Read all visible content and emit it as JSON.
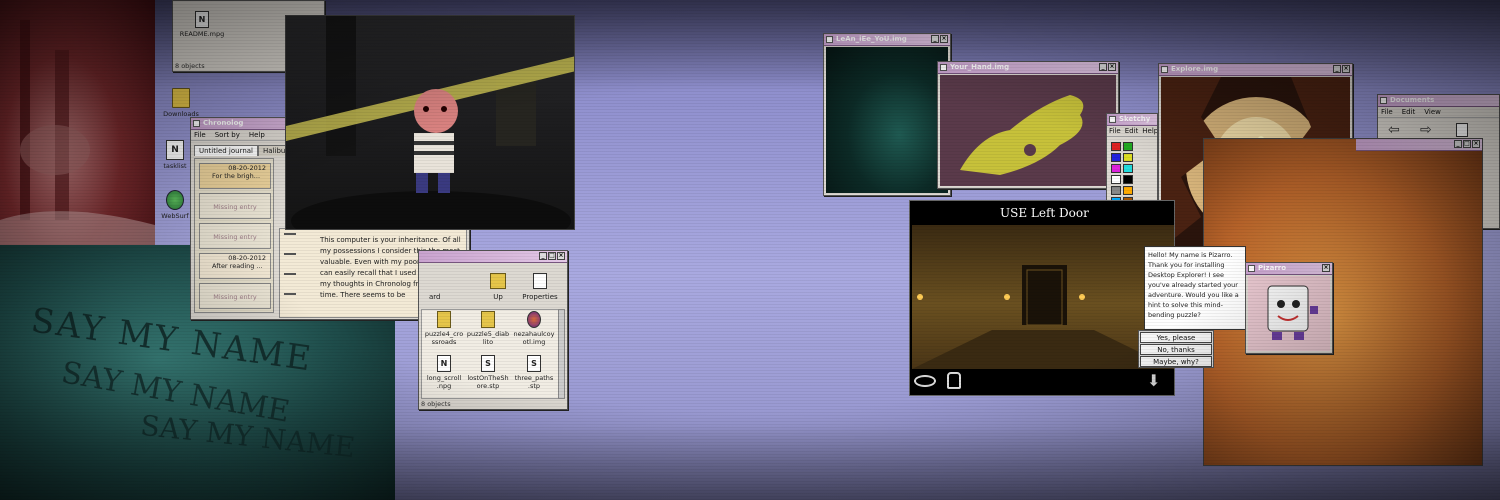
{
  "colors": {
    "desktop": "#a9a9e0",
    "titlebar": "#c9a3cf",
    "window_face": "#ddd9d2",
    "chronolog_entry": "#f0e6d2"
  },
  "desktop_icons": [
    {
      "label": "Downloads",
      "icon": "folder-icon"
    },
    {
      "label": "tasklist",
      "icon": "notepad-icon"
    },
    {
      "label": "WebSurf",
      "icon": "globe-icon"
    }
  ],
  "top_window": {
    "file_label": "README.mpg",
    "status": "8 objects"
  },
  "chronolog": {
    "title": "Chronolog",
    "menu": [
      "File",
      "Sort by",
      "Help"
    ],
    "tabs": [
      "Untitled journal",
      "Halibut's"
    ],
    "entries": [
      {
        "date": "08-20-2012",
        "preview": "For the brigh...",
        "missing": false
      },
      {
        "label": "Missing entry",
        "missing": true
      },
      {
        "label": "Missing entry",
        "missing": true
      },
      {
        "date": "08-20-2012",
        "preview": "After reading ...",
        "missing": false
      },
      {
        "label": "Missing entry",
        "missing": true
      }
    ],
    "journal_text": "This computer is your inheritance. Of all my possessions I consider this the most valuable. Even with my poor memory, I can easily recall that I used to record my thoughts in Chronolog from time to time. There seems to be"
  },
  "explorer_small": {
    "toolbar": [
      "ard",
      "Up",
      "Properties"
    ],
    "files": [
      {
        "label": "puzzle4_crossroads",
        "lines": [
          "puzzle4_cro",
          "ssroads"
        ],
        "icon": "folder-icon"
      },
      {
        "label": "puzzle5_diablito",
        "lines": [
          "puzzle5_diab",
          "lito"
        ],
        "icon": "folder-icon"
      },
      {
        "label": "nezahaulcoyotl.img",
        "lines": [
          "nezahaulcoy",
          "otl.img"
        ],
        "icon": "image-icon"
      },
      {
        "label": "long_scroll.npg",
        "lines": [
          "long_scroll",
          ".npg"
        ],
        "icon": "notepad-icon"
      },
      {
        "label": "lostOnTheShore.stp",
        "lines": [
          "lostOnTheSh",
          "ore.stp"
        ],
        "icon": "script-icon"
      },
      {
        "label": "three_paths.stp",
        "lines": [
          "three_paths",
          ".stp"
        ],
        "icon": "script-icon"
      }
    ],
    "status": "8 objects"
  },
  "windows": {
    "learn_img": "LeAn_iEe_YoU.img",
    "hand_img": "Your_Hand.img",
    "explore_img": "Explore.img",
    "documents": "Documents",
    "sketchy": "Sketchy",
    "pizarro": "Pizarro"
  },
  "documents_menu": [
    "File",
    "Edit",
    "View"
  ],
  "sketchy_menu": [
    "File",
    "Edit",
    "Help"
  ],
  "palette": [
    "#d22",
    "#2a2",
    "#22d",
    "#dd2",
    "#d2d",
    "#2dd",
    "#fff",
    "#000",
    "#888",
    "#fa0",
    "#0af",
    "#a50"
  ],
  "game": {
    "caption": "USE Left Door"
  },
  "pizarro_dialog": {
    "message": "Hello! My name is Pizarro. Thank you for installing Desktop Explorer! I see you've already started your adventure. Would you like a hint to solve this mind-bending puzzle?",
    "buttons": [
      "Yes, please",
      "No, thanks",
      "Maybe, why?"
    ]
  },
  "wall_text": "SAY MY NAME"
}
